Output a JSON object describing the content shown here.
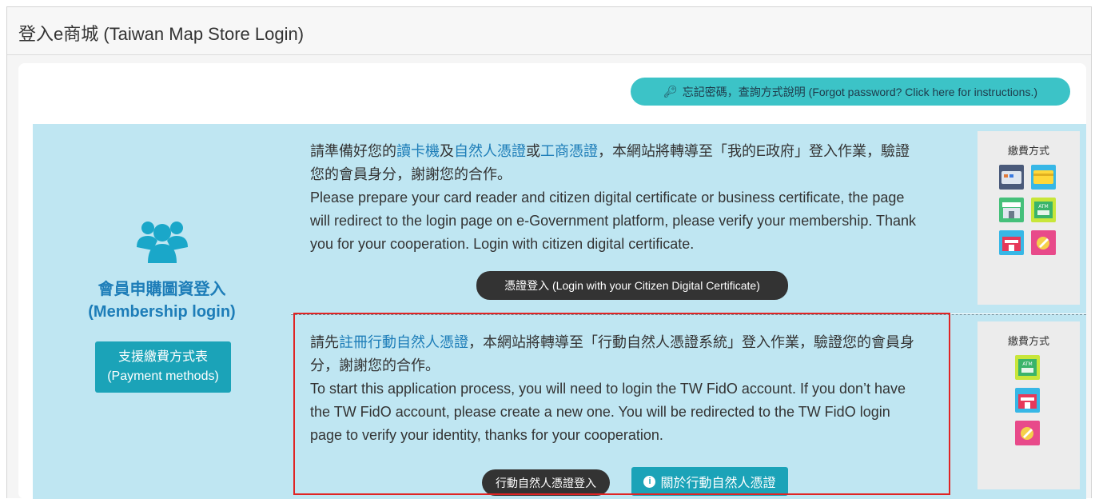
{
  "header": {
    "title": "登入e商城 (Taiwan Map Store Login)"
  },
  "forgot": {
    "icon": "key-icon",
    "label": "忘記密碼，查詢方式說明 (Forgot password? Click here for instructions.)"
  },
  "member": {
    "icon": "users-icon",
    "title_zh": "會員申購圖資登入",
    "title_en": "(Membership login)",
    "payment_button": {
      "line1": "支援繳費方式表",
      "line2": "(Payment methods)"
    }
  },
  "section1": {
    "zh_1": "請準備好您的",
    "link_1": "讀卡機",
    "zh_2": "及",
    "link_2": "自然人憑證",
    "zh_3": "或",
    "link_3": "工商憑證",
    "zh_4": "，本網站將轉導至「我的E政府」登入作業，驗證您的會員身分，謝謝您的合作。",
    "en": "Please prepare your card reader and citizen digital certificate or business certificate, the page will redirect to the login page on e-Government platform, please verify your membership. Thank you for your cooperation. Login with citizen digital certificate.",
    "button": "憑證登入 (Login with your Citizen Digital Certificate)",
    "payment_title": "繳費方式",
    "payment_icons": [
      "card-reader-icon",
      "credit-card-icon",
      "convenience-store-icon",
      "atm-icon",
      "post-office-icon",
      "gift-payment-icon"
    ]
  },
  "section2": {
    "zh_1": "請先",
    "link_1": "註冊行動自然人憑證",
    "zh_2": "，本網站將轉導至「行動自然人憑證系統」登入作業，驗證您的會員身分，謝謝您的合作。",
    "en": "To start this application process, you will need to login the TW FidO account. If you don’t have the TW FidO account, please create a new one. You will be redirected to the TW FidO login page to verify your identity, thanks for your cooperation.",
    "login_button": "行動自然人憑證登入",
    "about_button": "關於行動自然人憑證",
    "payment_title": "繳費方式",
    "payment_icons": [
      "atm-icon",
      "post-office-icon",
      "gift-payment-icon"
    ]
  },
  "colors": {
    "accent": "#3cc3c7",
    "panel": "#bfe6f2",
    "link": "#1d7db8",
    "highlight_border": "#e02424"
  }
}
